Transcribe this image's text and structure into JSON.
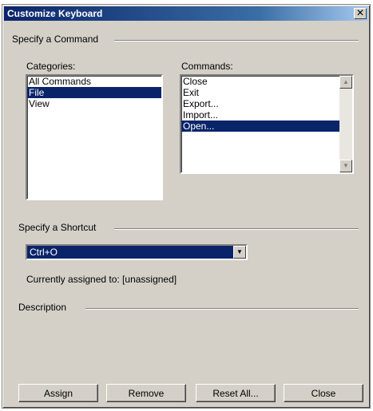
{
  "window": {
    "title": "Customize Keyboard",
    "close_glyph": "✕"
  },
  "command_group": {
    "label": "Specify a Command",
    "categories_label": "Categories:",
    "categories": [
      {
        "label": "All Commands",
        "selected": false
      },
      {
        "label": "File",
        "selected": true
      },
      {
        "label": "View",
        "selected": false
      }
    ],
    "commands_label": "Commands:",
    "commands": [
      {
        "label": "Close",
        "selected": false
      },
      {
        "label": "Exit",
        "selected": false
      },
      {
        "label": "Export...",
        "selected": false
      },
      {
        "label": "Import...",
        "selected": false
      },
      {
        "label": "Open...",
        "selected": true
      }
    ]
  },
  "shortcut_group": {
    "label": "Specify a Shortcut",
    "value": "Ctrl+O",
    "assigned_text": "Currently assigned to: [unassigned]"
  },
  "description_group": {
    "label": "Description"
  },
  "buttons": {
    "assign": "Assign",
    "remove": "Remove",
    "reset_all": "Reset All...",
    "close": "Close"
  },
  "colors": {
    "titlebar": "#0a246a",
    "selection": "#0a246a",
    "face": "#d4d0c8"
  }
}
